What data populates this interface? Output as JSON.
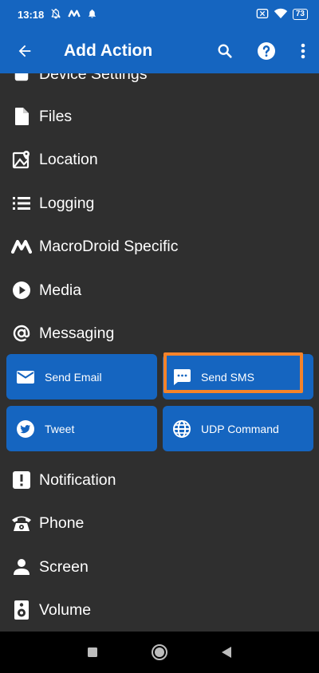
{
  "status_bar": {
    "time": "13:18",
    "battery": "73",
    "icons": [
      "bell-off-icon",
      "m-logo-icon",
      "bell-icon",
      "sim-off-icon",
      "wifi-icon",
      "battery-icon"
    ]
  },
  "app_bar": {
    "title": "Add Action",
    "icons": [
      "back-arrow-icon",
      "search-icon",
      "help-icon",
      "more-vert-icon"
    ]
  },
  "list": {
    "partial_item": "Device Settings",
    "categories_top": [
      {
        "label": "Files",
        "icon": "file-icon"
      },
      {
        "label": "Location",
        "icon": "location-map-icon"
      },
      {
        "label": "Logging",
        "icon": "list-icon"
      },
      {
        "label": "MacroDroid Specific",
        "icon": "macrodroid-icon"
      },
      {
        "label": "Media",
        "icon": "play-icon"
      },
      {
        "label": "Messaging",
        "icon": "at-icon"
      }
    ],
    "messaging_actions": [
      {
        "label": "Send Email",
        "icon": "email-icon"
      },
      {
        "label": "Send SMS",
        "icon": "sms-icon",
        "highlighted": true
      },
      {
        "label": "Tweet",
        "icon": "twitter-icon"
      },
      {
        "label": "UDP Command",
        "icon": "globe-icon"
      }
    ],
    "categories_bottom": [
      {
        "label": "Notification",
        "icon": "notification-icon"
      },
      {
        "label": "Phone",
        "icon": "phone-icon"
      },
      {
        "label": "Screen",
        "icon": "person-icon"
      },
      {
        "label": "Volume",
        "icon": "speaker-icon"
      }
    ]
  },
  "colors": {
    "primary": "#1565c0",
    "background": "#2f2f2f",
    "highlight": "#f5832a"
  }
}
